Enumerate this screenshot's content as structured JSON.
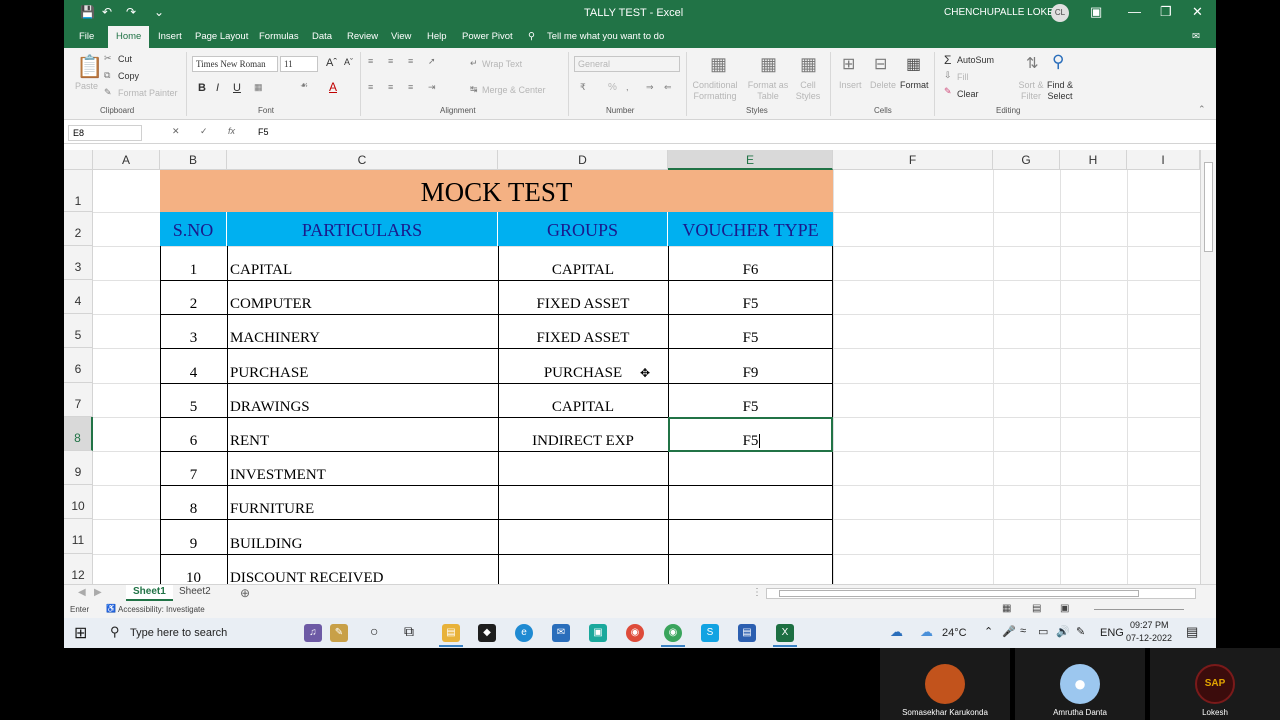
{
  "window": {
    "doc_title": "TALLY TEST  -  Excel",
    "user_name": "CHENCHUPALLE LOKESH",
    "user_initials": "CL"
  },
  "menu": {
    "tabs": [
      "File",
      "Home",
      "Insert",
      "Page Layout",
      "Formulas",
      "Data",
      "Review",
      "View",
      "Help",
      "Power Pivot"
    ],
    "active": "Home",
    "tell_me": "Tell me what you want to do"
  },
  "ribbon": {
    "clipboard": {
      "label": "Clipboard",
      "paste": "Paste",
      "cut": "Cut",
      "copy": "Copy",
      "format_painter": "Format Painter"
    },
    "font": {
      "label": "Font",
      "name": "Times New Roman",
      "size": "11",
      "bold": "B",
      "italic": "I",
      "underline": "U"
    },
    "alignment": {
      "label": "Alignment",
      "wrap_text": "Wrap Text",
      "merge_center": "Merge & Center"
    },
    "number": {
      "label": "Number",
      "format": "General",
      "percent": "%"
    },
    "styles": {
      "label": "Styles",
      "conditional": "Conditional Formatting",
      "format_table": "Format as Table",
      "cell_styles": "Cell Styles"
    },
    "cells": {
      "label": "Cells",
      "insert": "Insert",
      "delete": "Delete",
      "format": "Format"
    },
    "editing": {
      "label": "Editing",
      "autosum": "AutoSum",
      "fill": "Fill",
      "clear": "Clear",
      "sort_filter": "Sort & Filter",
      "find_select": "Find & Select"
    }
  },
  "formula_bar": {
    "name_box": "E8",
    "content": "F5"
  },
  "sheet": {
    "columns": [
      "A",
      "B",
      "C",
      "D",
      "E",
      "F",
      "G",
      "H",
      "I"
    ],
    "selected_column": "E",
    "rows": [
      "1",
      "2",
      "3",
      "4",
      "5",
      "6",
      "7",
      "8",
      "9",
      "10",
      "11",
      "12"
    ],
    "selected_row": "8",
    "title": "MOCK TEST",
    "headers": [
      "S.NO",
      "PARTICULARS",
      "GROUPS",
      "VOUCHER TYPE"
    ],
    "data": [
      {
        "sno": "1",
        "particulars": "CAPITAL",
        "group": "CAPITAL",
        "voucher": "F6"
      },
      {
        "sno": "2",
        "particulars": "COMPUTER",
        "group": "FIXED ASSET",
        "voucher": "F5"
      },
      {
        "sno": "3",
        "particulars": "MACHINERY",
        "group": "FIXED ASSET",
        "voucher": "F5"
      },
      {
        "sno": "4",
        "particulars": "PURCHASE",
        "group": "PURCHASE",
        "voucher": "F9"
      },
      {
        "sno": "5",
        "particulars": "DRAWINGS",
        "group": "CAPITAL",
        "voucher": "F5"
      },
      {
        "sno": "6",
        "particulars": "RENT",
        "group": "INDIRECT EXP",
        "voucher": "F5"
      },
      {
        "sno": "7",
        "particulars": "INVESTMENT",
        "group": "",
        "voucher": ""
      },
      {
        "sno": "8",
        "particulars": "FURNITURE",
        "group": "",
        "voucher": ""
      },
      {
        "sno": "9",
        "particulars": "BUILDING",
        "group": "",
        "voucher": ""
      },
      {
        "sno": "10",
        "particulars": "DISCOUNT RECEIVED",
        "group": "",
        "voucher": ""
      }
    ]
  },
  "sheet_tabs": [
    "Sheet1",
    "Sheet2"
  ],
  "active_sheet": "Sheet1",
  "status": {
    "mode": "Enter",
    "accessibility": "Accessibility: Investigate"
  },
  "taskbar": {
    "search_placeholder": "Type here to search",
    "temperature": "24°C",
    "language": "ENG",
    "time": "09:27 PM",
    "date": "07-12-2022"
  },
  "participants": [
    {
      "name": "Somasekhar Karukonda"
    },
    {
      "name": "Amrutha Danta"
    },
    {
      "name": "Lokesh",
      "badge": "SAP"
    }
  ],
  "colors": {
    "excel_green": "#217346",
    "title_fill": "#f4b183",
    "header_fill": "#00b0f0"
  }
}
